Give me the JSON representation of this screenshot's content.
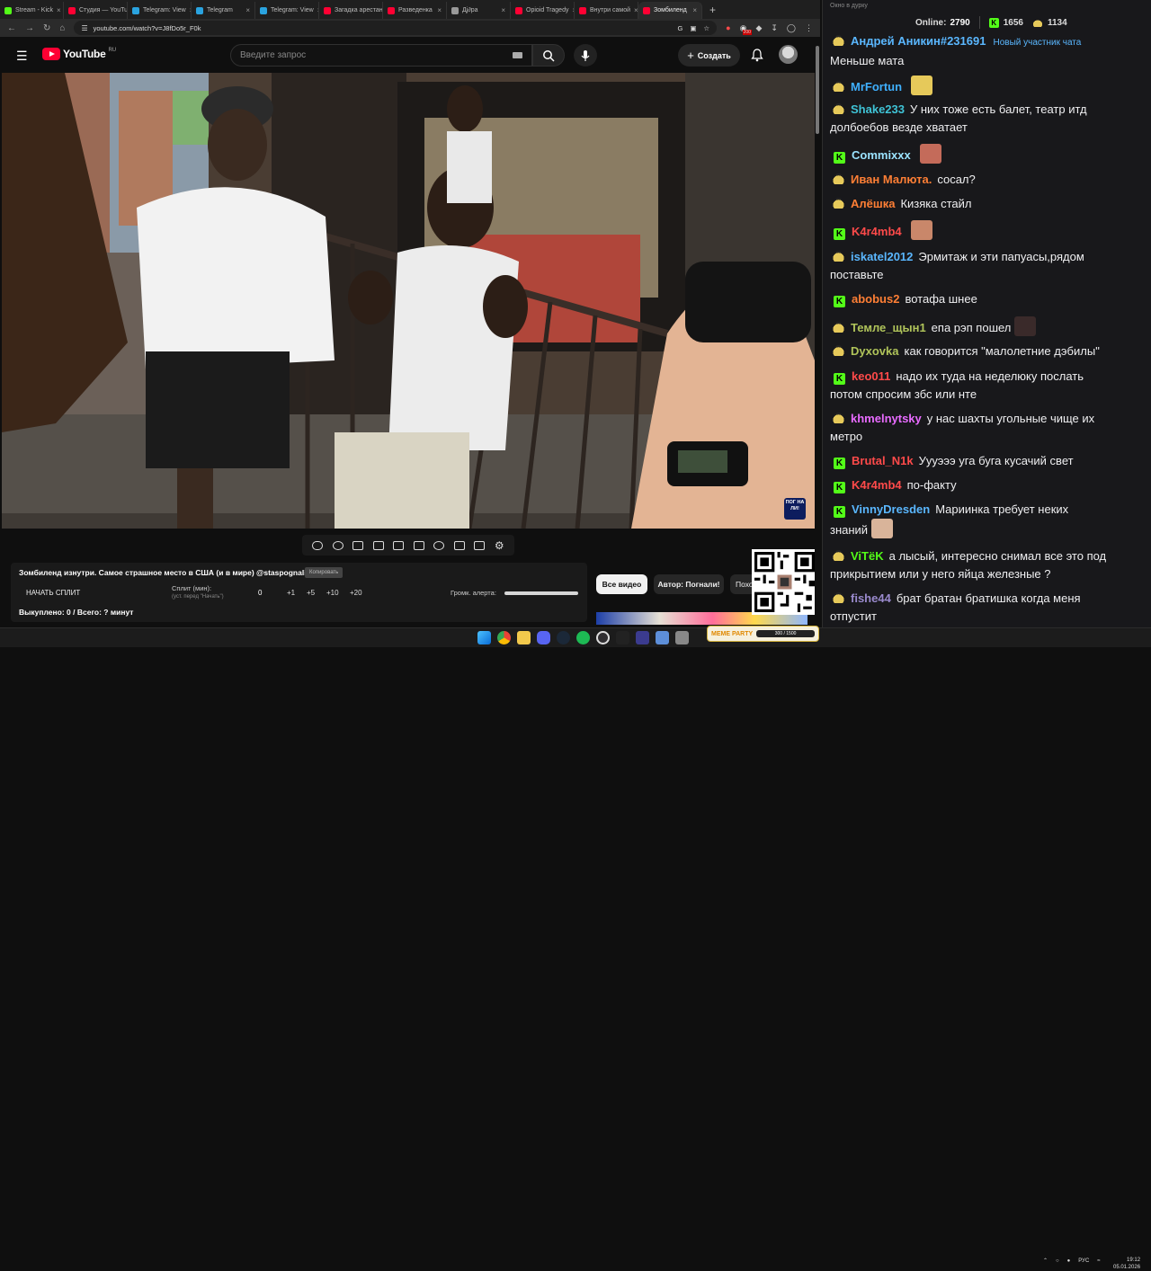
{
  "browser": {
    "tabs": [
      {
        "label": "Stream - Kick",
        "color": "#53fc18",
        "active": false
      },
      {
        "label": "Студия — YouTube",
        "color": "#ff0033",
        "active": false
      },
      {
        "label": "Telegram: View",
        "color": "#2aa3df",
        "active": false
      },
      {
        "label": "Telegram",
        "color": "#2aa3df",
        "active": false
      },
      {
        "label": "Telegram: View",
        "color": "#2aa3df",
        "active": false
      },
      {
        "label": "Загадка арестан",
        "color": "#ff0033",
        "active": false
      },
      {
        "label": "Разведенка",
        "color": "#ff0033",
        "active": false
      },
      {
        "label": "Дj∂ра",
        "color": "#999999",
        "active": false
      },
      {
        "label": "Opioid Tragedy",
        "color": "#ff0033",
        "active": false
      },
      {
        "label": "Внутри самой",
        "color": "#ff0033",
        "active": false
      },
      {
        "label": "Зомбиленд",
        "color": "#ff0033",
        "active": true
      }
    ],
    "url": "youtube.com/watch?v=J8fDo5r_F0k",
    "zoom_badge": "200"
  },
  "youtube": {
    "logo_text": "YouTube",
    "region": "RU",
    "search_placeholder": "Введите запрос",
    "create_label": "Создать",
    "video_badge_text": "ПОГ НА ЛИ!",
    "video_title": "Зомбиленд изнутри. Самое страшное место в США (и в мире) @staspognali",
    "edit_chip": "Копировать",
    "start_split": "НАЧАТЬ СПЛИТ",
    "split_label": "Сплит (мин):",
    "split_hint": "(уст. перед \"Начать\")",
    "split_value": "0",
    "steps": [
      "+1",
      "+5",
      "+10",
      "+20"
    ],
    "alert_label": "Громк. алерта:",
    "bought": "Выкуплено: 0 / Всего: ? минут",
    "chips": {
      "all": "Все видео",
      "author": "Автор: Погнали!",
      "more": "Похожие"
    }
  },
  "chat": {
    "window_title": "Окно в дурку",
    "online_label": "Online:",
    "online_count": "2790",
    "kick_count": "1656",
    "other_count": "1134",
    "messages": [
      {
        "badge": "pepe",
        "nick": "Андрей Аникин#231691",
        "color": "#5ab7ff",
        "tag": "Новый участник чата",
        "text": "",
        "line2": "Меньше мата",
        "emote": ""
      },
      {
        "badge": "pepe",
        "nick": "MrFortun",
        "color": "#3fb0ff",
        "tag": "",
        "text": "",
        "line2": "",
        "emote": "#e6c95a"
      },
      {
        "badge": "pepe",
        "nick": "Shake233",
        "color": "#3fc3d6",
        "tag": "",
        "text": "У них тоже есть балет, театр итд",
        "line2": "долбоебов везде хватает",
        "emote": ""
      },
      {
        "badge": "kick",
        "nick": "Commixxx",
        "color": "#9be3ff",
        "tag": "",
        "text": "",
        "line2": "",
        "emote": "#c46b5a"
      },
      {
        "badge": "pepe",
        "nick": "Иван Малюта.",
        "color": "#ff7f35",
        "tag": "",
        "text": "сосал?",
        "line2": "",
        "emote": ""
      },
      {
        "badge": "pepe",
        "nick": "Алёшка",
        "color": "#ff7f35",
        "tag": "",
        "text": "Кизяка стайл",
        "line2": "",
        "emote": ""
      },
      {
        "badge": "kick",
        "nick": "K4r4mb4",
        "color": "#ff4a4a",
        "tag": "",
        "text": "",
        "line2": "",
        "emote": "#c9876a"
      },
      {
        "badge": "pepe",
        "nick": "iskatel2012",
        "color": "#5ab7ff",
        "tag": "",
        "text": "Эрмитаж и эти папуасы,рядом",
        "line2": "поставьте",
        "emote": ""
      },
      {
        "badge": "kick",
        "nick": "abobus2",
        "color": "#ff7f35",
        "tag": "",
        "text": "вотафа шнее",
        "line2": "",
        "emote": ""
      },
      {
        "badge": "pepe",
        "nick": "Темле_щын1",
        "color": "#b0c45a",
        "tag": "",
        "text": "епа рэп пошел",
        "line2": "",
        "emote": "#3a2a2a"
      },
      {
        "badge": "pepe",
        "nick": "Dyxovka",
        "color": "#b0c45a",
        "tag": "",
        "text": "как говорится \"малолетние дэбилы\"",
        "line2": "",
        "emote": ""
      },
      {
        "badge": "kick",
        "nick": "keo011",
        "color": "#ff4a4a",
        "tag": "",
        "text": "надо их туда на неделюку послать",
        "line2": "потом спросим збс или нте",
        "emote": ""
      },
      {
        "badge": "pepe",
        "nick": "khmelnytsky",
        "color": "#e86bff",
        "tag": "",
        "text": "у нас шахты угольные чище их",
        "line2": "метро",
        "emote": ""
      },
      {
        "badge": "kick",
        "nick": "Brutal_N1k",
        "color": "#ff4a4a",
        "tag": "",
        "text": "Уууэээ уга буга кусачий свет",
        "line2": "",
        "emote": ""
      },
      {
        "badge": "kick",
        "nick": "K4r4mb4",
        "color": "#ff4a4a",
        "tag": "",
        "text": "по-факту",
        "line2": "",
        "emote": ""
      },
      {
        "badge": "kick",
        "nick": "VinnyDresden",
        "color": "#5ab7ff",
        "tag": "",
        "text": "Мариинка требует неких",
        "line2": "знаний",
        "emote": "#d9b49a"
      },
      {
        "badge": "pepe",
        "nick": "ViTёK",
        "color": "#53fc18",
        "tag": "",
        "text": "а лысый, интересно снимал все это под",
        "line2": "прикрытием или у него яйца железные ?",
        "emote": ""
      },
      {
        "badge": "pepe",
        "nick": "fishe44",
        "color": "#9a8acd",
        "tag": "",
        "text": "брат братан братишка когда меня",
        "line2": "отпустит",
        "emote": ""
      }
    ]
  },
  "taskbar": {
    "meme_title": "MEME PARTY",
    "meme_progress": "300 / 1500",
    "lang": "РУС",
    "time": "19:12",
    "date": "05.01.2026"
  }
}
